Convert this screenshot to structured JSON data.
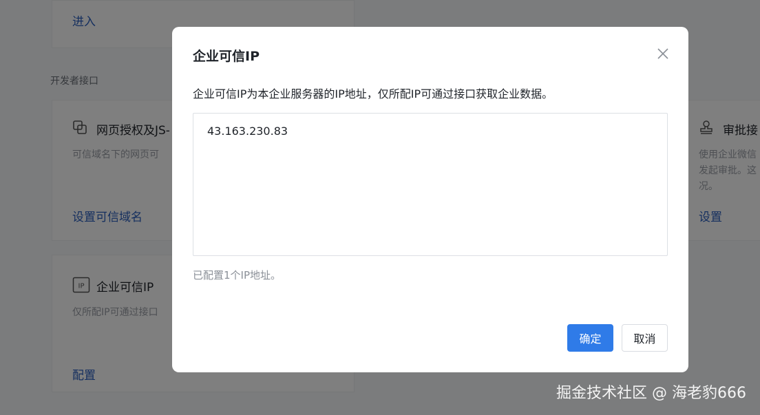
{
  "background": {
    "enter_link": "进入",
    "section_label": "开发者接口",
    "card_web_auth": {
      "title": "网页授权及JS-",
      "desc": "可信域名下的网页可",
      "action": "设置可信域名"
    },
    "card_trusted_ip": {
      "title": "企业可信IP",
      "desc": "仅所配IP可通过接口",
      "action": "配置"
    },
    "card_approval": {
      "title": "审批接",
      "desc_line1": "使用企业微信",
      "desc_line2": "发起审批。这",
      "desc_line3": "况。",
      "action": "设置"
    }
  },
  "dialog": {
    "title": "企业可信IP",
    "description": "企业可信IP为本企业服务器的IP地址，仅所配IP可通过接口获取企业数据。",
    "ip_value": "43.163.230.83",
    "hint": "已配置1个IP地址。",
    "confirm_label": "确定",
    "cancel_label": "取消"
  },
  "watermark": "掘金技术社区 @ 海老豹666",
  "colors": {
    "primary": "#2f7be8",
    "link": "#2a5fbf",
    "overlay": "rgba(0,0,0,0.5)"
  }
}
